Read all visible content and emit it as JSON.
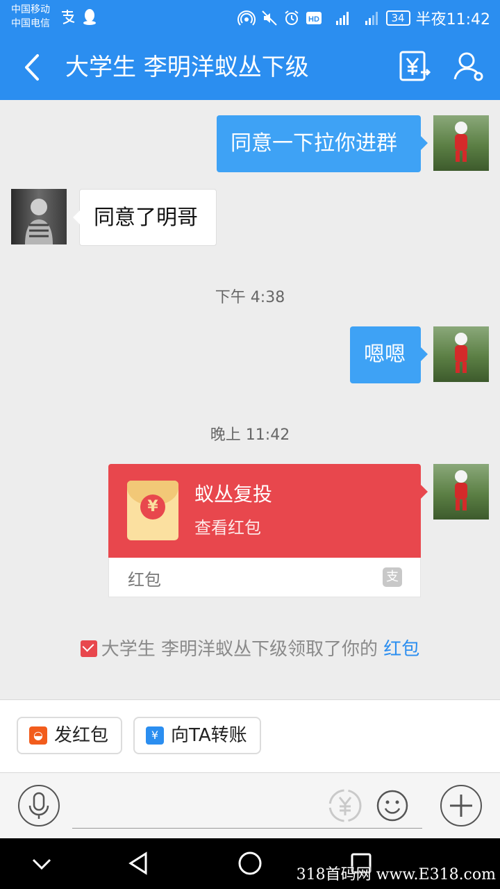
{
  "status_bar": {
    "carrier_1": "中国移动",
    "carrier_2": "中国电信",
    "battery": "34",
    "time": "半夜11:42"
  },
  "header": {
    "title": "大学生 李明洋蚁丛下级"
  },
  "messages": [
    {
      "sender": "me",
      "text": "同意一下拉你进群"
    },
    {
      "sender": "other",
      "text": "同意了明哥"
    },
    {
      "sender": "me",
      "text": "嗯嗯"
    }
  ],
  "timestamps": [
    "下午 4:38",
    "晚上 11:42"
  ],
  "red_packet": {
    "title": "蚁丛复投",
    "subtitle": "查看红包",
    "label": "红包",
    "coin_symbol": "¥"
  },
  "notice": {
    "text": "大学生 李明洋蚁丛下级领取了你的",
    "link": "红包"
  },
  "quick_actions": {
    "red_packet_label": "发红包",
    "transfer_label": "向TA转账"
  },
  "colors": {
    "brand_blue": "#2b8ef0",
    "bubble_blue": "#3ea2f5",
    "packet_red": "#e8474d"
  },
  "watermark": "318首码网  www.E318.com"
}
